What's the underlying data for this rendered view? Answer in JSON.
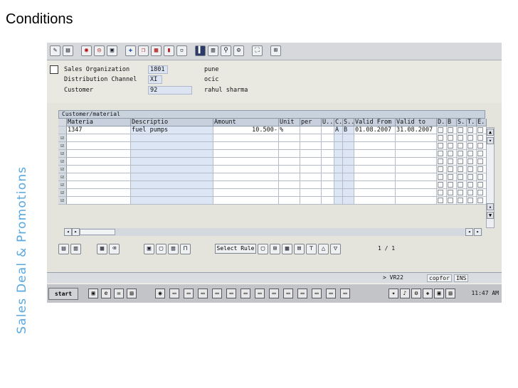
{
  "slide": {
    "title": "Conditions",
    "side_title": "Sales Deal & Promotions"
  },
  "header": {
    "fields": [
      {
        "label": "Sales Organization",
        "value": "1801",
        "description": "pune"
      },
      {
        "label": "Distribution Channel",
        "value": "XI",
        "description": "ocic"
      },
      {
        "label": "Customer",
        "value": "92",
        "description": "rahul sharma"
      }
    ]
  },
  "table": {
    "title": "Customer/material",
    "columns": [
      "Materia",
      "Descriptio",
      "Amount",
      "Unit",
      "per",
      "U..",
      "C..",
      "S..",
      "Valid From",
      "Valid to",
      "D..",
      "B",
      "S..",
      "T..",
      "E.."
    ],
    "rows": [
      {
        "material": "1347",
        "description": "fuel pumps",
        "amount": "10.500-",
        "unit": "%",
        "per": "",
        "uom": "",
        "calc": "A",
        "scale": "B",
        "valid_from": "01.08.2007",
        "valid_to": "31.08.2007"
      }
    ],
    "empty_rows": 9
  },
  "bottom_toolbar": {
    "select_rule_label": "Select Rule",
    "page_info": "1 / 1"
  },
  "status_bar": {
    "system": "> VR22",
    "client": "copfor",
    "mode": "INS"
  },
  "taskbar": {
    "start_label": "start",
    "clock": "11:47 AM"
  },
  "colors": {
    "side_title": "#5aa8e0",
    "input_fill": "#dce4f2",
    "grid_header": "#c7d0dc"
  },
  "icons": {
    "toolbar": [
      "display-change-icon",
      "display-icon",
      "back-icon",
      "exit-icon",
      "cancel-icon",
      "create-icon",
      "copy-icon",
      "print-icon",
      "find-icon",
      "find-next-icon",
      "first-page-icon",
      "prev-page-icon",
      "next-page-icon",
      "last-page-icon",
      "new-session-icon",
      "shortcut-icon"
    ],
    "bottom": [
      "details-icon",
      "other-icon",
      "condition-info-icon",
      "delete-icon",
      "select-all-icon",
      "deselect-icon",
      "first-icon",
      "prev-icon",
      "next-icon",
      "last-icon",
      "filter-icon",
      "sort-icon"
    ]
  }
}
